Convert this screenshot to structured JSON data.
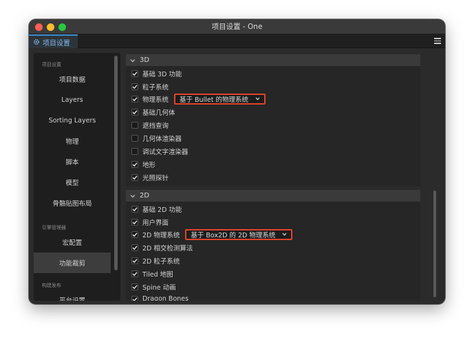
{
  "window": {
    "title": "项目设置 - One"
  },
  "tab": {
    "label": "项目设置",
    "icon": "gear-icon"
  },
  "sidebar": {
    "groups": [
      {
        "label": "项目设置",
        "items": [
          "项目数据",
          "Layers",
          "Sorting Layers",
          "物理",
          "脚本",
          "模型",
          "骨骼贴图布局"
        ]
      },
      {
        "label": "引擎管理器",
        "items": [
          "宏配置",
          "功能裁剪"
        ]
      },
      {
        "label": "构建发布",
        "items": [
          "平台设置"
        ]
      }
    ],
    "active_item": "功能裁剪"
  },
  "sections": [
    {
      "title": "3D",
      "rows": [
        {
          "label": "基础 3D 功能",
          "checked": true
        },
        {
          "label": "粒子系统",
          "checked": true
        },
        {
          "label": "物理系统",
          "checked": true,
          "select": "基于 Bullet 的物理系统"
        },
        {
          "label": "基础几何体",
          "checked": true
        },
        {
          "label": "遮挡查询",
          "checked": false
        },
        {
          "label": "几何体渲染器",
          "checked": false
        },
        {
          "label": "调试文字渲染器",
          "checked": false
        },
        {
          "label": "地形",
          "checked": true
        },
        {
          "label": "光照探针",
          "checked": true
        }
      ]
    },
    {
      "title": "2D",
      "rows": [
        {
          "label": "基础 2D 功能",
          "checked": true
        },
        {
          "label": "用户界面",
          "checked": true
        },
        {
          "label": "2D 物理系统",
          "checked": true,
          "select": "基于 Box2D 的 2D 物理系统"
        },
        {
          "label": "2D 相交检测算法",
          "checked": true
        },
        {
          "label": "2D 粒子系统",
          "checked": true
        },
        {
          "label": "Tiled 地图",
          "checked": true
        },
        {
          "label": "Spine 动画",
          "checked": true
        },
        {
          "label": "Dragon Bones",
          "checked": true
        }
      ]
    }
  ],
  "colors": {
    "accent": "#3a8fd0",
    "highlight_border": "#e0442b"
  }
}
